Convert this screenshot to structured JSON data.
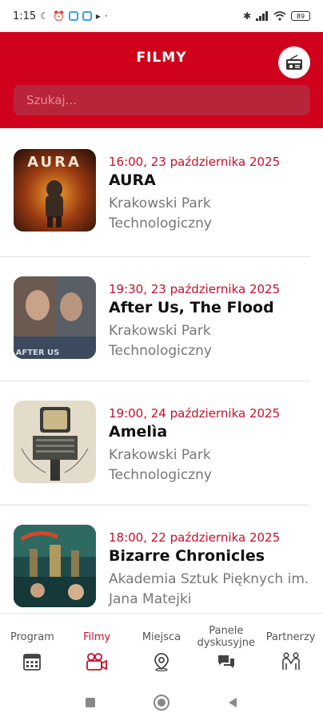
{
  "status_bar": {
    "time": "1:15",
    "battery": "89"
  },
  "header": {
    "title": "FILMY",
    "search_placeholder": "Szukaj...",
    "radio_icon": "radio-icon"
  },
  "films": [
    {
      "datetime": "16:00, 23 października 2025",
      "title": "AURA",
      "venue": "Krakowski Park Technologiczny",
      "poster_text": "AURA"
    },
    {
      "datetime": "19:30, 23 października 2025",
      "title": "After Us, The Flood",
      "venue": "Krakowski Park Technologiczny",
      "poster_text": "AFTER US"
    },
    {
      "datetime": "19:00, 24 października 2025",
      "title": "Amelìa",
      "venue": "Krakowski Park Technologiczny",
      "poster_text": ""
    },
    {
      "datetime": "18:00, 22 października 2025",
      "title": "Bizarre Chronicles",
      "venue": "Akademia Sztuk Pięknych im. Jana Matejki",
      "poster_text": ""
    }
  ],
  "tabs": [
    {
      "label": "Program",
      "icon": "calendar-icon",
      "active": false
    },
    {
      "label": "Filmy",
      "icon": "camera-icon",
      "active": true
    },
    {
      "label": "Miejsca",
      "icon": "location-pin-icon",
      "active": false
    },
    {
      "label": "Panele dyskusyjne",
      "icon": "chat-icon",
      "active": false
    },
    {
      "label": "Partnerzy",
      "icon": "partners-icon",
      "active": false
    }
  ],
  "colors": {
    "brand": "#d0021b",
    "accent_text": "#c8102e",
    "search_bg": "#b8243a"
  }
}
